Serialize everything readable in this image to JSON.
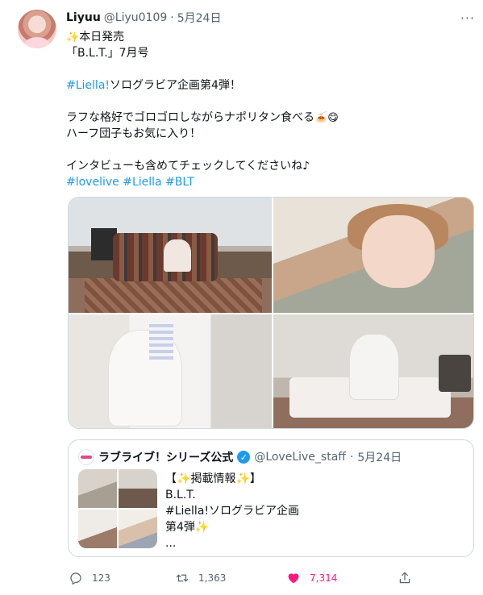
{
  "tweet": {
    "author_name": "Liyuu",
    "author_handle": "@Liyu0109",
    "separator": "·",
    "date": "5月24日",
    "more_label": "···",
    "lines": [
      "本日発売",
      "「B.L.T.」7月号",
      "",
      "ソログラビア企画第4弾！",
      "",
      "ラフな格好でゴロゴロしながらナポリタン食べる",
      "ハーフ団子もお気に入り！",
      "",
      "インタビューも含めてチェックしてくださいね♪"
    ],
    "hashtag_liella": "#Liella!",
    "tags_line": [
      "#lovelive",
      "#Liella",
      "#BLT"
    ]
  },
  "quote": {
    "name": "ラブライブ！シリーズ公式",
    "handle": "@LoveLive_staff",
    "separator": "·",
    "date": "5月24日",
    "verified_mark": "✓",
    "lines": [
      "【",
      "掲載情報",
      "】",
      "B.L.T.",
      "#Liella!ソログラビア企画",
      "第4弾",
      "..."
    ]
  },
  "actions": {
    "reply_count": "123",
    "retweet_count": "1,363",
    "like_count": "7,314"
  },
  "icons": [
    "sparkle-emoji-icon",
    "pasta-emoji-icon",
    "smile-emoji-icon",
    "verified-icon",
    "reply-icon",
    "retweet-icon",
    "heart-icon",
    "share-icon",
    "more-icon"
  ],
  "colors": {
    "link": "#1d9bf0",
    "like": "#f91880",
    "muted": "#536471",
    "border": "#cfd9de"
  }
}
